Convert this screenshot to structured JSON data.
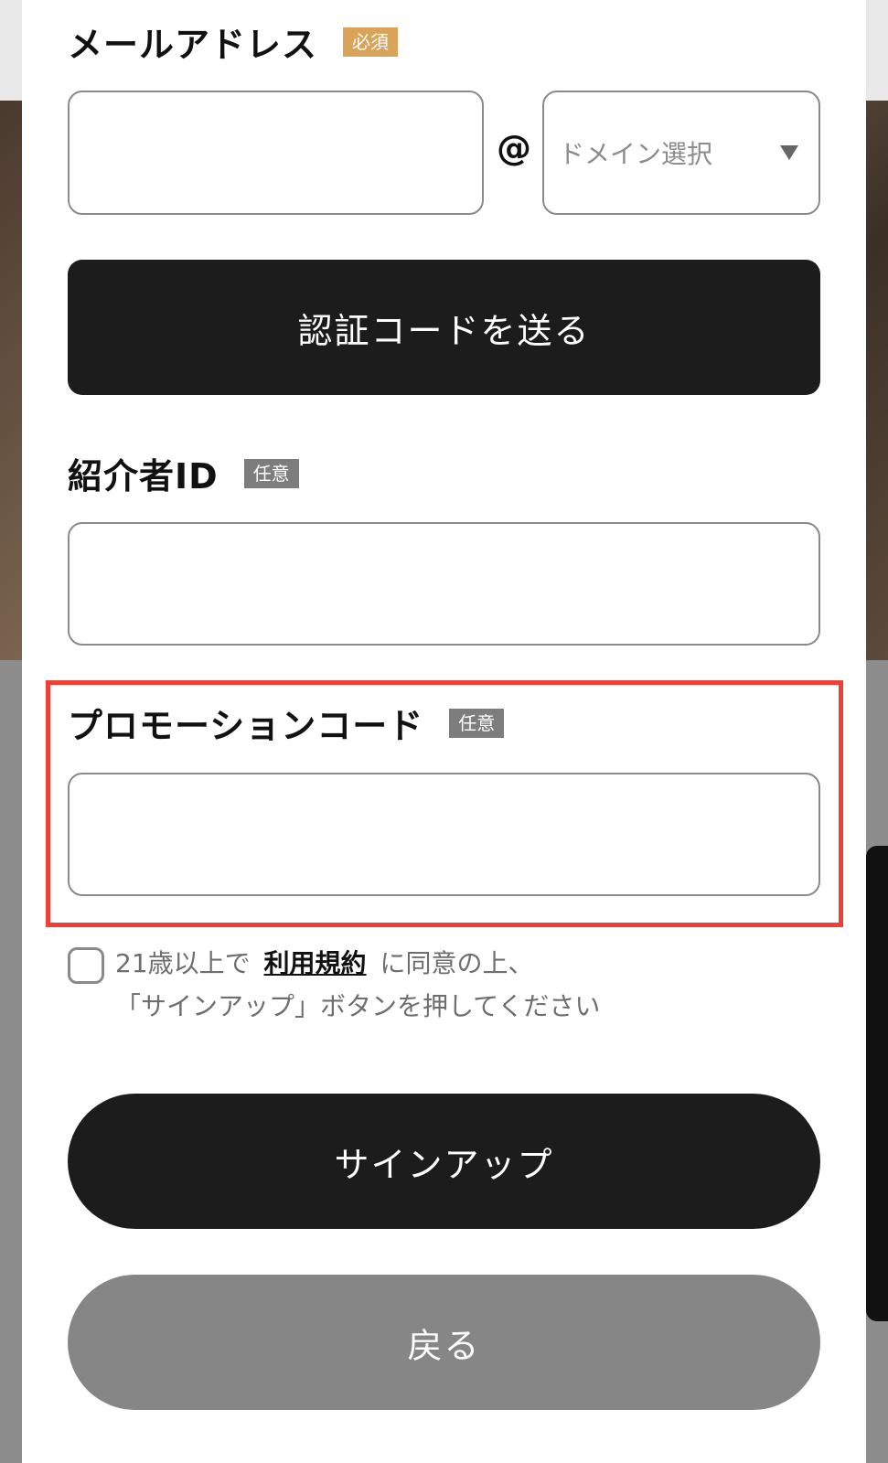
{
  "form": {
    "email": {
      "label": "メールアドレス",
      "badge": "必須",
      "at_sign": "@",
      "domain_placeholder": "ドメイン選択"
    },
    "send_code_button": "認証コードを送る",
    "referrer": {
      "label": "紹介者ID",
      "badge": "任意"
    },
    "promo": {
      "label": "プロモーションコード",
      "badge": "任意"
    },
    "terms": {
      "prefix": "21歳以上で",
      "link": "利用規約",
      "suffix": "に同意の上、",
      "line2": "「サインアップ」ボタンを押してください"
    },
    "signup_button": "サインアップ",
    "back_button": "戻る"
  },
  "colors": {
    "required_badge": "#d9a35a",
    "optional_badge": "#7d7d7d",
    "primary_button": "#1c1c1c",
    "secondary_button": "#868686",
    "highlight": "#ef3f36"
  }
}
